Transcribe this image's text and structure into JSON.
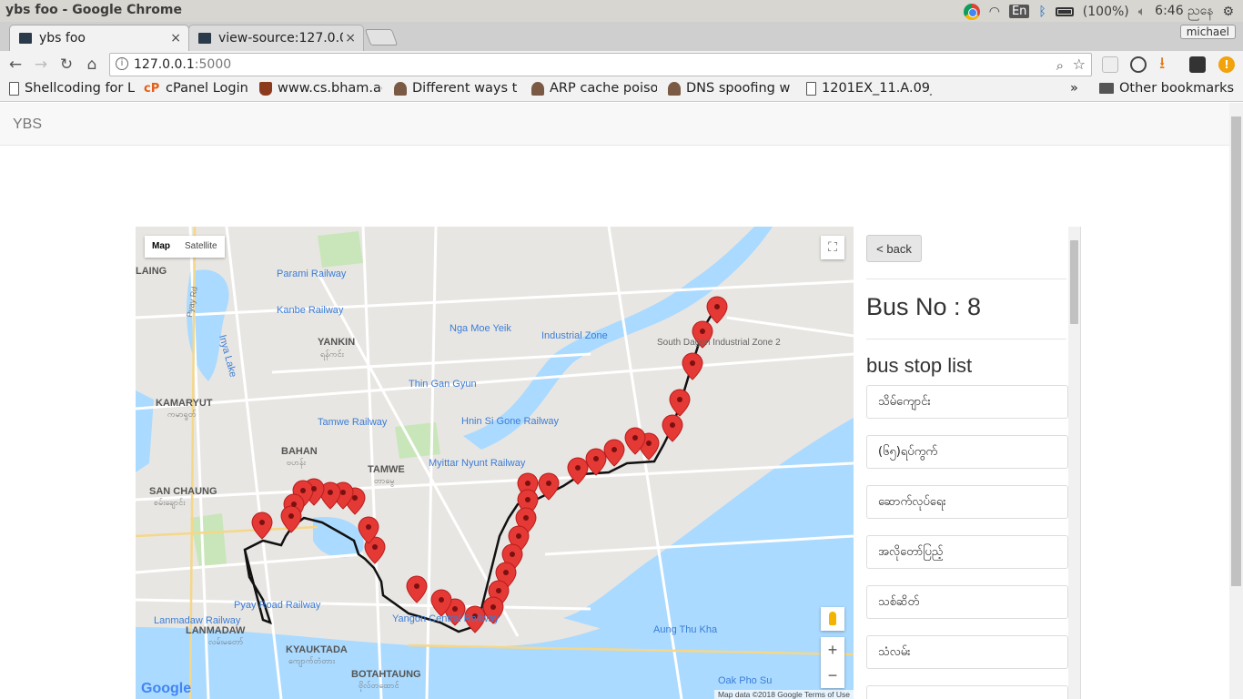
{
  "os": {
    "window_title": "ybs foo - Google Chrome",
    "lang": "En",
    "battery": "(100%)",
    "clock": "6:46 ညနေ"
  },
  "tabs": [
    {
      "label": "ybs foo"
    },
    {
      "label": "view-source:127.0.0"
    }
  ],
  "profile": "michael",
  "omnibox": {
    "host": "127.0.0.1",
    "port": ":5000"
  },
  "bookmarks": [
    {
      "label": "Shellcoding for L",
      "icon": "page-icon"
    },
    {
      "label": "cPanel Login",
      "icon": "cpanel-icon"
    },
    {
      "label": "www.cs.bham.ac",
      "icon": "shield-icon"
    },
    {
      "label": "Different ways t",
      "icon": "person-icon"
    },
    {
      "label": "ARP cache poiso",
      "icon": "person-icon"
    },
    {
      "label": "DNS spoofing w",
      "icon": "person-icon"
    },
    {
      "label": "1201EX_11.A.09_",
      "icon": "page-icon"
    }
  ],
  "bookmarks_overflow": "»",
  "other_bookmarks": "Other bookmarks",
  "brand": "YBS",
  "map": {
    "type_map": "Map",
    "type_satellite": "Satellite",
    "google": "Google",
    "attribution": "Map data ©2018 Google   Terms of Use",
    "labels": [
      "Parami Railway",
      "Kanbe Railway",
      "YANKIN",
      "ရန်ကင်း",
      "Nga Moe Yeik",
      "Industrial Zone",
      "South Dagon Industrial Zone 2",
      "Thin Gan Gyun",
      "KAMARYUT",
      "ကမာရွတ်",
      "Tamwe Railway",
      "Hnin Si Gone Railway",
      "BAHAN",
      "ဗဟန်း",
      "TAMWE",
      "တာမွေ",
      "Myittar Nyunt Railway",
      "SAN CHAUNG",
      "စမ်းချောင်း",
      "Pyay Road Railway",
      "Yangon Central Railway",
      "Lanmadaw Railway",
      "LANMADAW",
      "လမ်းမတော်",
      "KYAUKTADA",
      "ကျောက်တံတား",
      "BOTAHTAUNG",
      "ဗိုလ်တထောင်",
      "Aung Thu Kha",
      "Oak Pho Su",
      "Inya Lake",
      "Pyay Rd",
      "LAING"
    ]
  },
  "panel": {
    "back": "< back",
    "bus_no": "Bus No : 8",
    "stop_title": "bus stop list",
    "stops": [
      "သိမ်ကျောင်း",
      "(၆၅)ရပ်ကွက်",
      "ဆောက်လုပ်ရေး",
      "အလိုတော်ပြည့်",
      "သစ်ဆိတ်",
      "သံလမ်း"
    ]
  }
}
